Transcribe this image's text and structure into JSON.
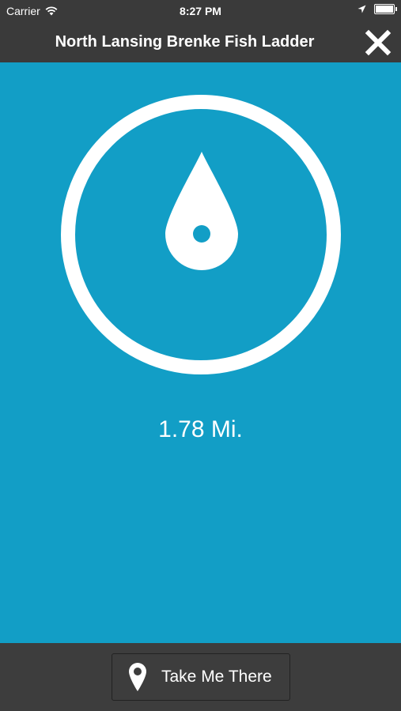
{
  "status_bar": {
    "carrier": "Carrier",
    "time": "8:27 PM",
    "icons": [
      "wifi-icon",
      "location-arrow-icon",
      "battery-icon"
    ]
  },
  "nav": {
    "title": "North Lansing Brenke Fish Ladder",
    "close_icon": "close-icon"
  },
  "main": {
    "icon": "water-drop-icon",
    "distance": "1.78 Mi."
  },
  "bottom": {
    "button_label": "Take Me There",
    "button_icon": "map-pin-icon"
  },
  "colors": {
    "background": "#129ec6",
    "bar": "#3a3a3a",
    "foreground": "#ffffff"
  }
}
